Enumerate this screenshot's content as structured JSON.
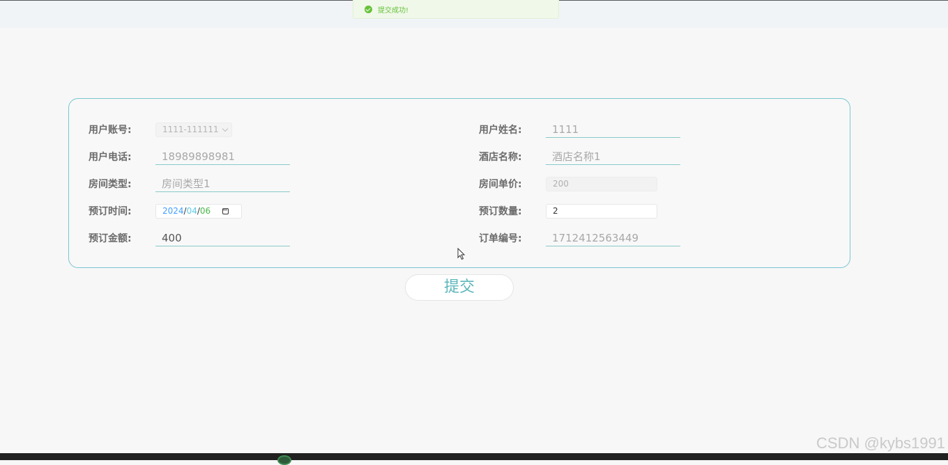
{
  "toast": {
    "message": "提交成功!",
    "icon": "check-circle-icon",
    "color": "#67c23a"
  },
  "form": {
    "user_account": {
      "label": "用户账号:",
      "value": "1111-111111"
    },
    "user_name": {
      "label": "用户姓名:",
      "value": "1111"
    },
    "user_phone": {
      "label": "用户电话:",
      "value": "18989898981"
    },
    "hotel_name": {
      "label": "酒店名称:",
      "value": "酒店名称1"
    },
    "room_type": {
      "label": "房间类型:",
      "value": "房间类型1"
    },
    "room_price": {
      "label": "房间单价:",
      "value": "200"
    },
    "booking_date": {
      "label": "预订时间:",
      "year": "2024",
      "month": "04",
      "day": "06",
      "sep": "/"
    },
    "booking_count": {
      "label": "预订数量:",
      "value": "2"
    },
    "booking_amount": {
      "label": "预订金额:",
      "value": "400"
    },
    "order_number": {
      "label": "订单编号:",
      "value": "1712412563449"
    }
  },
  "submit_label": "提交",
  "watermark": "CSDN @kybs1991",
  "colors": {
    "accent": "#5cb6bb",
    "border": "#78c6cf"
  }
}
